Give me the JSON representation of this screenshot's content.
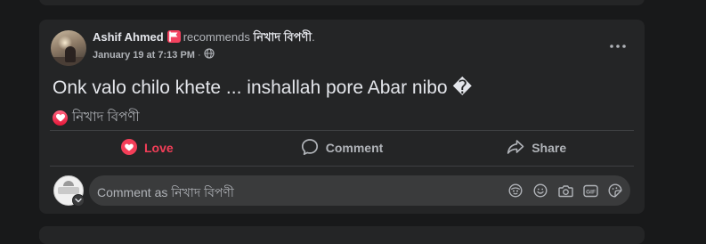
{
  "post": {
    "author": "Ashif Ahmed",
    "action_text": "recommends",
    "page_name": "নিখাদ বিপণী",
    "date": "January 19 at 7:13 PM",
    "separator": "·",
    "body": "Onk valo chilo khete ... inshallah pore Abar nibo �",
    "reaction": {
      "icon": "love-reaction-icon",
      "name": "নিখাদ বিপণী"
    }
  },
  "actions": {
    "love_label": "Love",
    "comment_label": "Comment",
    "share_label": "Share"
  },
  "comment": {
    "placeholder": "Comment as নিখাদ বিপণী"
  },
  "colors": {
    "card": "#242526",
    "page_bg": "#18191a",
    "love": "#f33e58",
    "muted_text": "#b0b3b8",
    "primary_text": "#e4e6eb"
  },
  "icons": {
    "recommend_badge": "recommend-flag-icon",
    "privacy": "globe-icon",
    "more": "more-options-icon",
    "love": "heart-icon",
    "comment": "comment-bubble-icon",
    "share": "share-arrow-icon",
    "tools": [
      "avatar-sticker-icon",
      "emoji-icon",
      "camera-icon",
      "gif-icon",
      "sticker-icon"
    ]
  }
}
